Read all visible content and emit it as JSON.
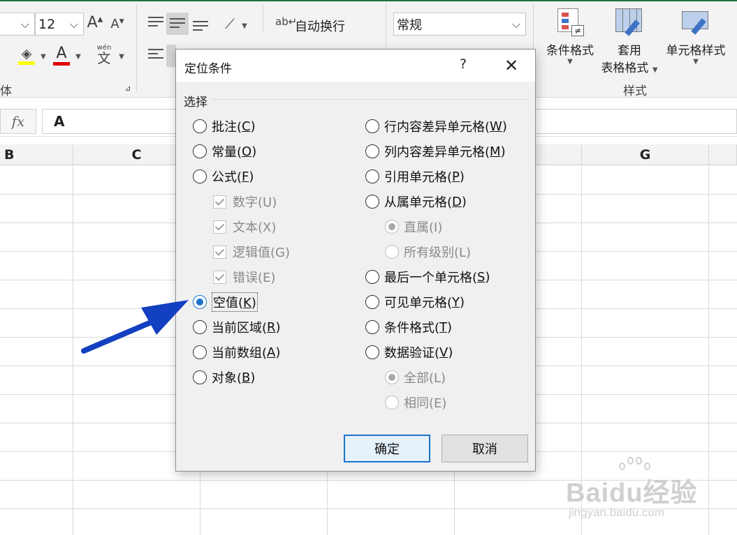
{
  "ribbon": {
    "font_size_value": "12",
    "font_group_label": "体",
    "wrap_text_label": "自动换行",
    "number_format_value": "常规",
    "wen_label": "wén",
    "wen_char": "文",
    "conditional_format_label": "条件格式",
    "table_format_label_line1": "套用",
    "table_format_label_line2": "表格格式",
    "cell_style_label": "单元格样式",
    "styles_group_label": "样式",
    "font_fill_color": "#ffff00",
    "font_color": "#e00000"
  },
  "formula_bar": {
    "fx_label": "fx",
    "value": "A"
  },
  "columns": [
    "B",
    "C",
    "G"
  ],
  "dialog": {
    "title": "定位条件",
    "help": "?",
    "close": "✕",
    "section_label": "选择",
    "left_options": [
      {
        "label": "批注(",
        "key": "C",
        "suffix": ")"
      },
      {
        "label": "常量(",
        "key": "O",
        "suffix": ")"
      },
      {
        "label": "公式(",
        "key": "F",
        "suffix": ")"
      },
      {
        "label": "数字(U)"
      },
      {
        "label": "文本(X)"
      },
      {
        "label": "逻辑值(G)"
      },
      {
        "label": "错误(E)"
      },
      {
        "label": "空值(",
        "key": "K",
        "suffix": ")"
      },
      {
        "label": "当前区域(",
        "key": "R",
        "suffix": ")"
      },
      {
        "label": "当前数组(",
        "key": "A",
        "suffix": ")"
      },
      {
        "label": "对象(",
        "key": "B",
        "suffix": ")"
      }
    ],
    "right_options": [
      {
        "label": "行内容差异单元格(",
        "key": "W",
        "suffix": ")"
      },
      {
        "label": "列内容差异单元格(",
        "key": "M",
        "suffix": ")"
      },
      {
        "label": "引用单元格(",
        "key": "P",
        "suffix": ")"
      },
      {
        "label": "从属单元格(",
        "key": "D",
        "suffix": ")"
      },
      {
        "label": "直属(I)"
      },
      {
        "label": "所有级别(L)"
      },
      {
        "label": "最后一个单元格(",
        "key": "S",
        "suffix": ")"
      },
      {
        "label": "可见单元格(",
        "key": "Y",
        "suffix": ")"
      },
      {
        "label": "条件格式(",
        "key": "T",
        "suffix": ")"
      },
      {
        "label": "数据验证(",
        "key": "V",
        "suffix": ")"
      },
      {
        "label": "全部(L)"
      },
      {
        "label": "相同(E)"
      }
    ],
    "ok_label": "确定",
    "cancel_label": "取消",
    "accent_color": "#1a73c9"
  },
  "annotation": {
    "arrow_color": "#1340c0"
  },
  "watermark": {
    "main": "Baidu经验",
    "sub": "jingyan.baidu.com"
  }
}
